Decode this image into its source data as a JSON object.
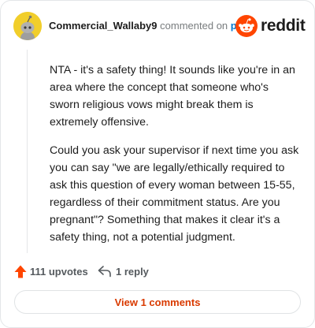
{
  "comment": {
    "username": "Commercial_Wallaby9",
    "verb": "commented on",
    "target": "post",
    "paragraphs": [
      "NTA - it's a safety thing! It sounds like you're in an area where the concept that someone who's sworn religious vows might break them is extremely offensive.",
      "Could you ask your supervisor if next time you ask you can say \"we are legally/ethically required to ask this question of every woman between 15-55, regardless of their commitment status. Are you pregnant\"? Something that makes it clear it's a safety thing, not a potential judgment."
    ]
  },
  "brand": {
    "name": "reddit",
    "color": "#ff4500"
  },
  "actions": {
    "upvotes": "111 upvotes",
    "replies": "1 reply",
    "upvote_icon": "upvote-arrow-icon",
    "reply_icon": "reply-arrow-icon",
    "upvote_color": "#ff4500"
  },
  "view_comments_label": "View 1 comments"
}
